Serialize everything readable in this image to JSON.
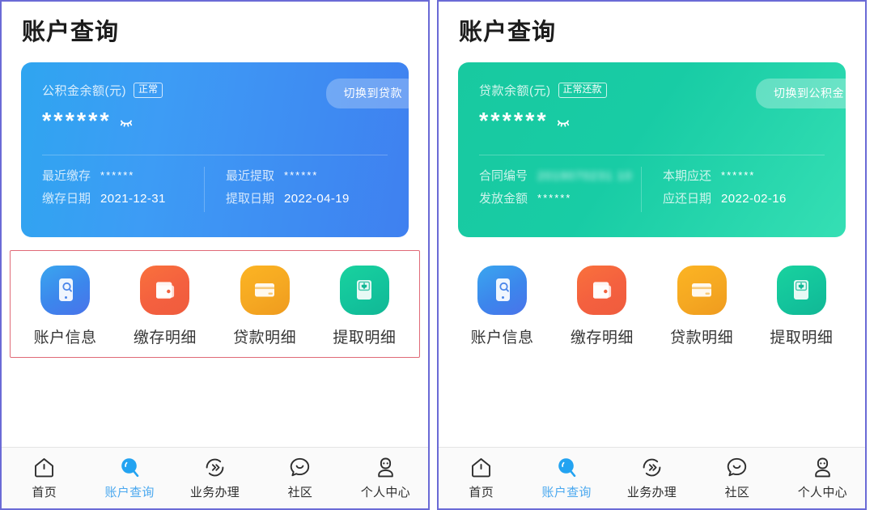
{
  "theme": {
    "panel_border": "#6a6ad6",
    "highlight_red": "#e06a77",
    "fund_accent": "#3d9cf5",
    "loan_accent": "#18cca5",
    "tab_active": "#4aa8ef"
  },
  "panels": [
    {
      "id": "fund-panel",
      "page_title": "账户查询",
      "card": {
        "variant": "fund",
        "balance_label": "公积金余额(元)",
        "status_badge": "正常",
        "switch_button": "切换到贷款",
        "balance_value": "******",
        "eye_icon": "eye-off-icon",
        "columns": [
          {
            "rows": [
              {
                "key": "最近缴存",
                "value": "******",
                "style": "mask"
              },
              {
                "key": "缴存日期",
                "value": "2021-12-31",
                "style": "plain"
              }
            ]
          },
          {
            "rows": [
              {
                "key": "最近提取",
                "value": "******",
                "style": "mask"
              },
              {
                "key": "提取日期",
                "value": "2022-04-19",
                "style": "plain"
              }
            ]
          }
        ]
      },
      "grid_highlighted": true,
      "grid": [
        {
          "label": "账户信息",
          "icon": "phone-search-icon",
          "color": "ic-blue"
        },
        {
          "label": "缴存明细",
          "icon": "wallet-icon",
          "color": "ic-orange"
        },
        {
          "label": "贷款明细",
          "icon": "credit-card-icon",
          "color": "ic-yellow"
        },
        {
          "label": "提取明细",
          "icon": "atm-withdraw-icon",
          "color": "ic-green"
        }
      ],
      "tabs": [
        {
          "label": "首页",
          "icon": "home-icon",
          "active": false
        },
        {
          "label": "账户查询",
          "icon": "search-bubble-icon",
          "active": true
        },
        {
          "label": "业务办理",
          "icon": "transfer-arrows-icon",
          "active": false
        },
        {
          "label": "社区",
          "icon": "smiley-icon",
          "active": false
        },
        {
          "label": "个人中心",
          "icon": "user-icon",
          "active": false
        }
      ]
    },
    {
      "id": "loan-panel",
      "page_title": "账户查询",
      "card": {
        "variant": "loan",
        "balance_label": "贷款余额(元)",
        "status_badge": "正常还款",
        "switch_button": "切换到公积金",
        "balance_value": "******",
        "eye_icon": "eye-off-icon",
        "columns": [
          {
            "rows": [
              {
                "key": "合同编号",
                "value": "2019070231 10",
                "style": "blur"
              },
              {
                "key": "发放金额",
                "value": "******",
                "style": "mask"
              }
            ]
          },
          {
            "rows": [
              {
                "key": "本期应还",
                "value": "******",
                "style": "mask"
              },
              {
                "key": "应还日期",
                "value": "2022-02-16",
                "style": "plain"
              }
            ]
          }
        ]
      },
      "grid_highlighted": false,
      "grid": [
        {
          "label": "账户信息",
          "icon": "phone-search-icon",
          "color": "ic-blue"
        },
        {
          "label": "缴存明细",
          "icon": "wallet-icon",
          "color": "ic-orange"
        },
        {
          "label": "贷款明细",
          "icon": "credit-card-icon",
          "color": "ic-yellow"
        },
        {
          "label": "提取明细",
          "icon": "atm-withdraw-icon",
          "color": "ic-green"
        }
      ],
      "tabs": [
        {
          "label": "首页",
          "icon": "home-icon",
          "active": false
        },
        {
          "label": "账户查询",
          "icon": "search-bubble-icon",
          "active": true
        },
        {
          "label": "业务办理",
          "icon": "transfer-arrows-icon",
          "active": false
        },
        {
          "label": "社区",
          "icon": "smiley-icon",
          "active": false
        },
        {
          "label": "个人中心",
          "icon": "user-icon",
          "active": false
        }
      ]
    }
  ]
}
